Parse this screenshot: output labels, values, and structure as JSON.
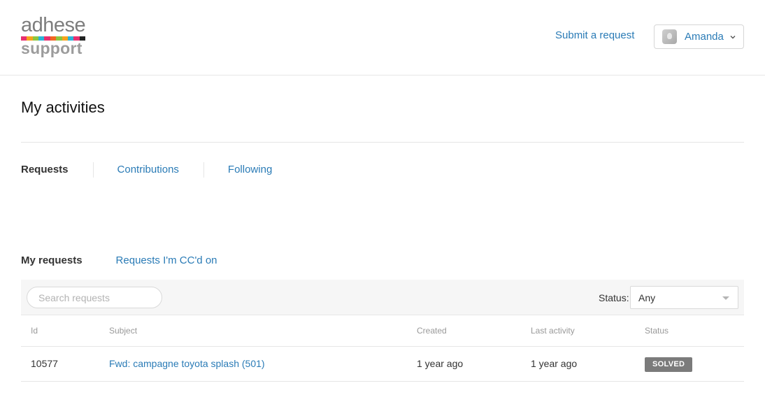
{
  "brand": {
    "logo_top": "adhese",
    "logo_bottom": "support",
    "stripe_colors": [
      "#e8306f",
      "#f7a41d",
      "#8dc63f",
      "#2bb5d8",
      "#e8306f",
      "#f26722",
      "#8dc63f",
      "#f7a41d",
      "#2bb5d8",
      "#e8306f",
      "#222222"
    ]
  },
  "header": {
    "submit_label": "Submit a request",
    "user_name": "Amanda"
  },
  "page": {
    "title": "My activities"
  },
  "tabs": [
    {
      "label": "Requests",
      "active": true
    },
    {
      "label": "Contributions",
      "active": false
    },
    {
      "label": "Following",
      "active": false
    }
  ],
  "subtabs": [
    {
      "label": "My requests",
      "active": true
    },
    {
      "label": "Requests I'm CC'd on",
      "active": false
    }
  ],
  "filter": {
    "search_placeholder": "Search requests",
    "status_label": "Status:",
    "status_value": "Any"
  },
  "table": {
    "headers": [
      "Id",
      "Subject",
      "Created",
      "Last activity",
      "Status"
    ],
    "rows": [
      {
        "id": "10577",
        "subject": "Fwd: campagne toyota splash (501)",
        "created": "1 year ago",
        "last_activity": "1 year ago",
        "status": "SOLVED"
      }
    ]
  },
  "colors": {
    "link": "#2a7bb6",
    "badge_solved": "#7b7b7b"
  }
}
